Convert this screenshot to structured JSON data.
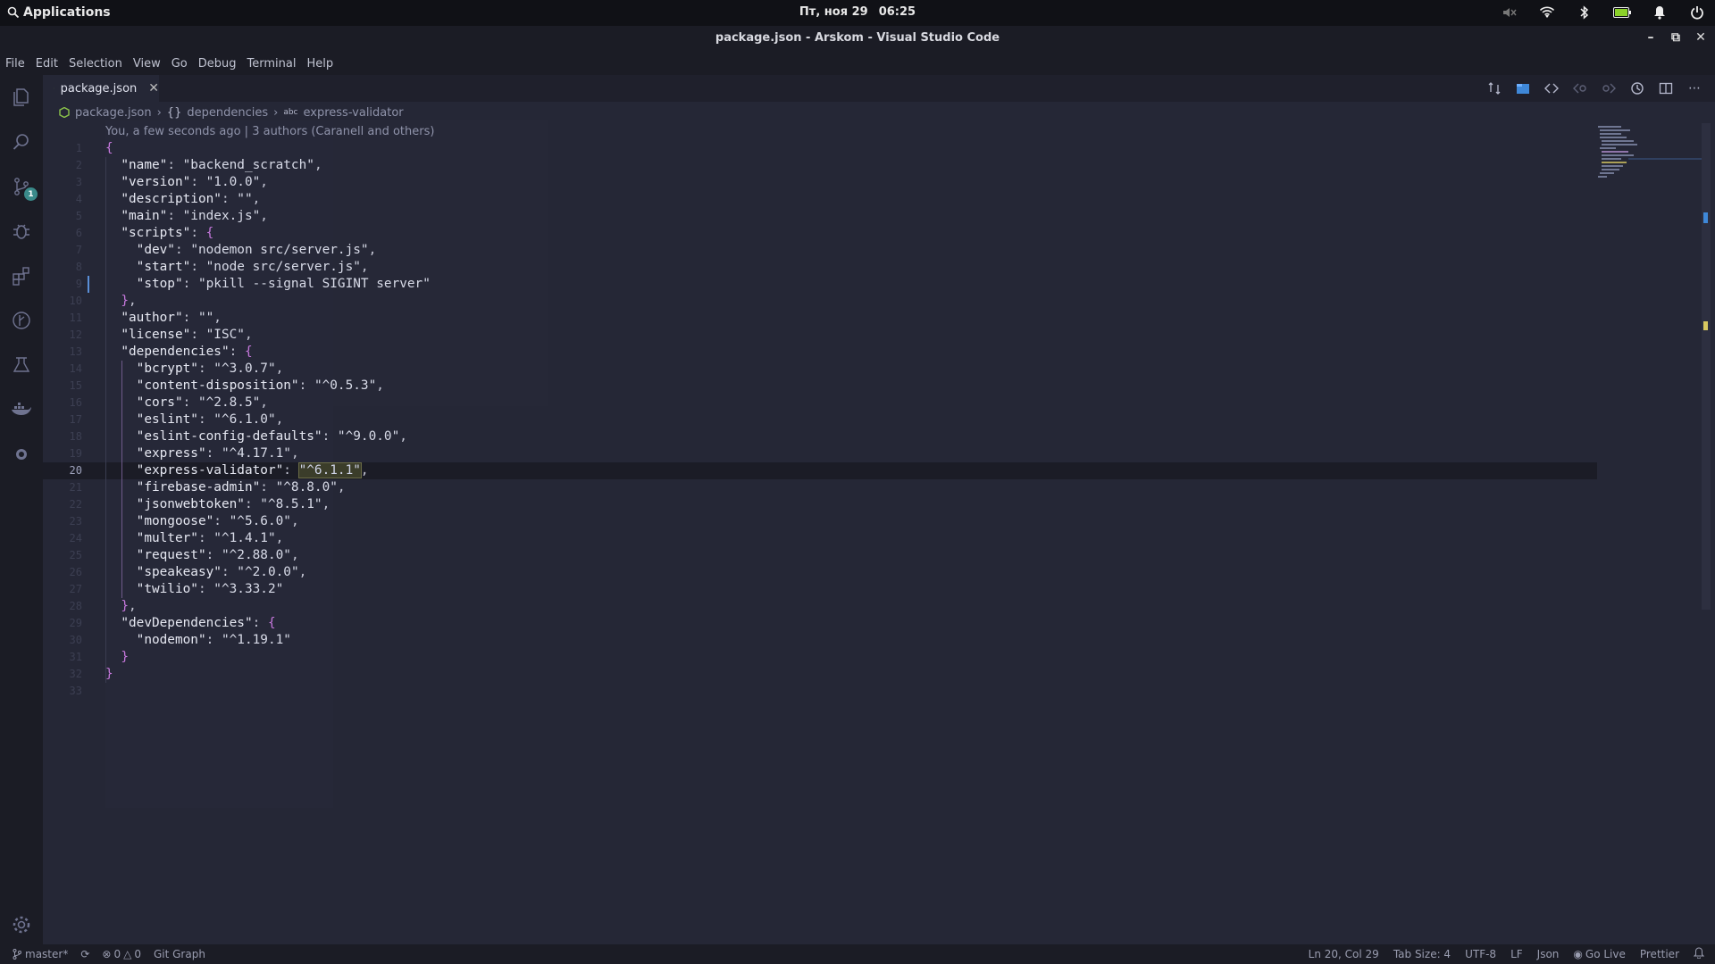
{
  "topbar": {
    "apps_label": "Applications",
    "date": "Пт, ноя 29",
    "time": "06:25"
  },
  "window": {
    "title": "package.json - Arskom - Visual Studio Code"
  },
  "menu": [
    "File",
    "Edit",
    "Selection",
    "View",
    "Go",
    "Debug",
    "Terminal",
    "Help"
  ],
  "activity": {
    "scm_badge": "1"
  },
  "tab": {
    "label": "package.json"
  },
  "breadcrumb": {
    "file": "package.json",
    "section": "dependencies",
    "item": "express-validator"
  },
  "blame": "You, a few seconds ago | 3 authors (Caranell and others)",
  "editor": {
    "active_line": 20,
    "lines": [
      {
        "n": "1",
        "segs": [
          [
            "b",
            "{"
          ]
        ]
      },
      {
        "n": "2",
        "segs": [
          [
            "p",
            "  "
          ],
          [
            "k",
            "\"name\""
          ],
          [
            "p",
            ": "
          ],
          [
            "s",
            "\"backend_scratch\""
          ],
          [
            "p",
            ","
          ]
        ]
      },
      {
        "n": "3",
        "segs": [
          [
            "p",
            "  "
          ],
          [
            "k",
            "\"version\""
          ],
          [
            "p",
            ": "
          ],
          [
            "s",
            "\"1.0.0\""
          ],
          [
            "p",
            ","
          ]
        ]
      },
      {
        "n": "4",
        "segs": [
          [
            "p",
            "  "
          ],
          [
            "k",
            "\"description\""
          ],
          [
            "p",
            ": "
          ],
          [
            "s",
            "\"\""
          ],
          [
            "p",
            ","
          ]
        ]
      },
      {
        "n": "5",
        "segs": [
          [
            "p",
            "  "
          ],
          [
            "k",
            "\"main\""
          ],
          [
            "p",
            ": "
          ],
          [
            "s",
            "\"index.js\""
          ],
          [
            "p",
            ","
          ]
        ]
      },
      {
        "n": "6",
        "segs": [
          [
            "p",
            "  "
          ],
          [
            "k",
            "\"scripts\""
          ],
          [
            "p",
            ": "
          ],
          [
            "b",
            "{"
          ]
        ]
      },
      {
        "n": "7",
        "segs": [
          [
            "p",
            "    "
          ],
          [
            "k",
            "\"dev\""
          ],
          [
            "p",
            ": "
          ],
          [
            "s",
            "\"nodemon src/server.js\""
          ],
          [
            "p",
            ","
          ]
        ]
      },
      {
        "n": "8",
        "segs": [
          [
            "p",
            "    "
          ],
          [
            "k",
            "\"start\""
          ],
          [
            "p",
            ": "
          ],
          [
            "s",
            "\"node src/server.js\""
          ],
          [
            "p",
            ","
          ]
        ]
      },
      {
        "n": "9",
        "segs": [
          [
            "p",
            "    "
          ],
          [
            "k",
            "\"stop\""
          ],
          [
            "p",
            ": "
          ],
          [
            "s",
            "\"pkill --signal SIGINT server\""
          ]
        ]
      },
      {
        "n": "10",
        "segs": [
          [
            "p",
            "  "
          ],
          [
            "b",
            "}"
          ],
          [
            "p",
            ","
          ]
        ]
      },
      {
        "n": "11",
        "segs": [
          [
            "p",
            "  "
          ],
          [
            "k",
            "\"author\""
          ],
          [
            "p",
            ": "
          ],
          [
            "s",
            "\"\""
          ],
          [
            "p",
            ","
          ]
        ]
      },
      {
        "n": "12",
        "segs": [
          [
            "p",
            "  "
          ],
          [
            "k",
            "\"license\""
          ],
          [
            "p",
            ": "
          ],
          [
            "s",
            "\"ISC\""
          ],
          [
            "p",
            ","
          ]
        ]
      },
      {
        "n": "13",
        "segs": [
          [
            "p",
            "  "
          ],
          [
            "k",
            "\"dependencies\""
          ],
          [
            "p",
            ": "
          ],
          [
            "b",
            "{"
          ]
        ]
      },
      {
        "n": "14",
        "segs": [
          [
            "p",
            "    "
          ],
          [
            "k",
            "\"bcrypt\""
          ],
          [
            "p",
            ": "
          ],
          [
            "s",
            "\"^3.0.7\""
          ],
          [
            "p",
            ","
          ]
        ]
      },
      {
        "n": "15",
        "segs": [
          [
            "p",
            "    "
          ],
          [
            "k",
            "\"content-disposition\""
          ],
          [
            "p",
            ": "
          ],
          [
            "s",
            "\"^0.5.3\""
          ],
          [
            "p",
            ","
          ]
        ]
      },
      {
        "n": "16",
        "segs": [
          [
            "p",
            "    "
          ],
          [
            "k",
            "\"cors\""
          ],
          [
            "p",
            ": "
          ],
          [
            "s",
            "\"^2.8.5\""
          ],
          [
            "p",
            ","
          ]
        ]
      },
      {
        "n": "17",
        "segs": [
          [
            "p",
            "    "
          ],
          [
            "k",
            "\"eslint\""
          ],
          [
            "p",
            ": "
          ],
          [
            "s",
            "\"^6.1.0\""
          ],
          [
            "p",
            ","
          ]
        ]
      },
      {
        "n": "18",
        "segs": [
          [
            "p",
            "    "
          ],
          [
            "k",
            "\"eslint-config-defaults\""
          ],
          [
            "p",
            ": "
          ],
          [
            "s",
            "\"^9.0.0\""
          ],
          [
            "p",
            ","
          ]
        ]
      },
      {
        "n": "19",
        "segs": [
          [
            "p",
            "    "
          ],
          [
            "k",
            "\"express\""
          ],
          [
            "p",
            ": "
          ],
          [
            "s",
            "\"^4.17.1\""
          ],
          [
            "p",
            ","
          ]
        ]
      },
      {
        "n": "20",
        "segs": [
          [
            "p",
            "    "
          ],
          [
            "k",
            "\"express-validator\""
          ],
          [
            "p",
            ": "
          ],
          [
            "hl",
            "\"^6.1.1\""
          ],
          [
            "p",
            ","
          ]
        ]
      },
      {
        "n": "21",
        "segs": [
          [
            "p",
            "    "
          ],
          [
            "k",
            "\"firebase-admin\""
          ],
          [
            "p",
            ": "
          ],
          [
            "s",
            "\"^8.8.0\""
          ],
          [
            "p",
            ","
          ]
        ]
      },
      {
        "n": "22",
        "segs": [
          [
            "p",
            "    "
          ],
          [
            "k",
            "\"jsonwebtoken\""
          ],
          [
            "p",
            ": "
          ],
          [
            "s",
            "\"^8.5.1\""
          ],
          [
            "p",
            ","
          ]
        ]
      },
      {
        "n": "23",
        "segs": [
          [
            "p",
            "    "
          ],
          [
            "k",
            "\"mongoose\""
          ],
          [
            "p",
            ": "
          ],
          [
            "s",
            "\"^5.6.0\""
          ],
          [
            "p",
            ","
          ]
        ]
      },
      {
        "n": "24",
        "segs": [
          [
            "p",
            "    "
          ],
          [
            "k",
            "\"multer\""
          ],
          [
            "p",
            ": "
          ],
          [
            "s",
            "\"^1.4.1\""
          ],
          [
            "p",
            ","
          ]
        ]
      },
      {
        "n": "25",
        "segs": [
          [
            "p",
            "    "
          ],
          [
            "k",
            "\"request\""
          ],
          [
            "p",
            ": "
          ],
          [
            "s",
            "\"^2.88.0\""
          ],
          [
            "p",
            ","
          ]
        ]
      },
      {
        "n": "26",
        "segs": [
          [
            "p",
            "    "
          ],
          [
            "k",
            "\"speakeasy\""
          ],
          [
            "p",
            ": "
          ],
          [
            "s",
            "\"^2.0.0\""
          ],
          [
            "p",
            ","
          ]
        ]
      },
      {
        "n": "27",
        "segs": [
          [
            "p",
            "    "
          ],
          [
            "k",
            "\"twilio\""
          ],
          [
            "p",
            ": "
          ],
          [
            "s",
            "\"^3.33.2\""
          ]
        ]
      },
      {
        "n": "28",
        "segs": [
          [
            "p",
            "  "
          ],
          [
            "b",
            "}"
          ],
          [
            "p",
            ","
          ]
        ]
      },
      {
        "n": "29",
        "segs": [
          [
            "p",
            "  "
          ],
          [
            "k",
            "\"devDependencies\""
          ],
          [
            "p",
            ": "
          ],
          [
            "b",
            "{"
          ]
        ]
      },
      {
        "n": "30",
        "segs": [
          [
            "p",
            "    "
          ],
          [
            "k",
            "\"nodemon\""
          ],
          [
            "p",
            ": "
          ],
          [
            "s",
            "\"^1.19.1\""
          ]
        ]
      },
      {
        "n": "31",
        "segs": [
          [
            "p",
            "  "
          ],
          [
            "b",
            "}"
          ]
        ]
      },
      {
        "n": "32",
        "segs": [
          [
            "b",
            "}"
          ]
        ]
      },
      {
        "n": "33",
        "segs": []
      }
    ]
  },
  "status": {
    "branch": "master*",
    "errors": "0",
    "warnings": "0",
    "git_graph": "Git Graph",
    "position": "Ln 20, Col 29",
    "tab_size": "Tab Size: 4",
    "encoding": "UTF-8",
    "eol": "LF",
    "language": "Json",
    "go_live": "Go Live",
    "prettier": "Prettier"
  },
  "colors": {
    "background": "#252736",
    "sidebar": "#1b1c25",
    "topbar": "#101116",
    "accent": "#3a8a8a"
  }
}
